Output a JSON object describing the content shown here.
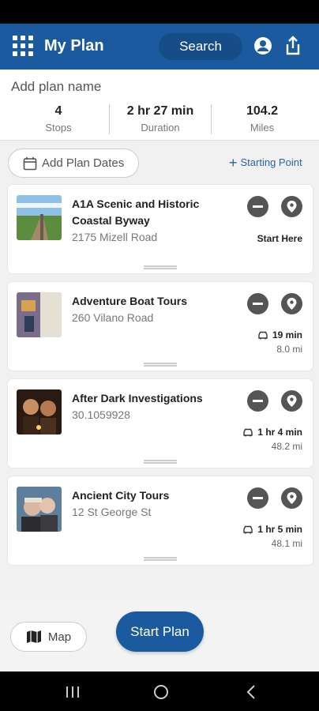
{
  "header": {
    "title": "My Plan",
    "search_label": "Search",
    "icons": [
      "grid-menu-icon",
      "profile-icon",
      "share-icon"
    ]
  },
  "summary": {
    "plan_name_placeholder": "Add plan name",
    "stats": [
      {
        "value": "4",
        "label": "Stops"
      },
      {
        "value": "2 hr 27 min",
        "label": "Duration"
      },
      {
        "value": "104.2",
        "label": "Miles"
      }
    ]
  },
  "actions": {
    "add_dates": "Add Plan Dates",
    "starting_point": "Starting Point"
  },
  "stops": [
    {
      "title": "A1A Scenic and Historic Coastal Byway",
      "address": "2175 Mizell Road",
      "note": "Start Here"
    },
    {
      "title": "Adventure Boat Tours",
      "address": "260 Vilano Road",
      "time": "19 min",
      "distance": "8.0 mi"
    },
    {
      "title": "After Dark Investigations",
      "address": "30.1059928",
      "time": "1 hr 4 min",
      "distance": "48.2 mi"
    },
    {
      "title": "Ancient City Tours",
      "address": "12 St George St",
      "time": "1 hr 5 min",
      "distance": "48.1 mi"
    }
  ],
  "footer": {
    "map_label": "Map",
    "start_label": "Start Plan"
  },
  "colors": {
    "brand": "#1b5a9e",
    "link": "#2a63a8"
  }
}
